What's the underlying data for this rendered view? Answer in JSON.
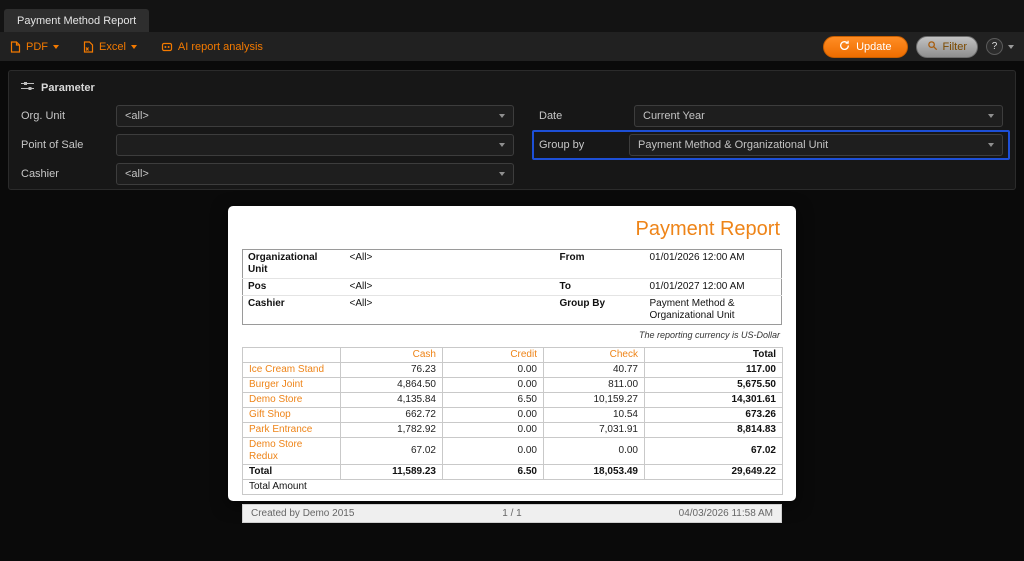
{
  "window": {
    "tab_title": "Payment Method Report"
  },
  "toolbar": {
    "pdf_label": "PDF",
    "excel_label": "Excel",
    "ai_label": "AI report analysis",
    "update_label": "Update",
    "filter_label": "Filter",
    "help_label": "?"
  },
  "parameters": {
    "title": "Parameter",
    "org_unit_label": "Org. Unit",
    "org_unit_value": "<all>",
    "point_of_sale_label": "Point of Sale",
    "point_of_sale_value": "",
    "cashier_label": "Cashier",
    "cashier_value": "<all>",
    "date_label": "Date",
    "date_value": "Current Year",
    "group_by_label": "Group by",
    "group_by_value": "Payment Method & Organizational Unit"
  },
  "report": {
    "title": "Payment Report",
    "info": {
      "org_unit_label": "Organizational Unit",
      "org_unit_value": "<All>",
      "pos_label": "Pos",
      "pos_value": "<All>",
      "cashier_label": "Cashier",
      "cashier_value": "<All>",
      "from_label": "From",
      "from_value": "01/01/2026 12:00 AM",
      "to_label": "To",
      "to_value": "01/01/2027 12:00 AM",
      "group_by_label": "Group By",
      "group_by_value": "Payment Method & Organizational Unit"
    },
    "currency_note": "The reporting currency is US-Dollar",
    "table": {
      "columns": [
        "",
        "Cash",
        "Credit",
        "Check",
        "Total"
      ],
      "rows": [
        [
          "Ice Cream Stand",
          "76.23",
          "0.00",
          "40.77",
          "117.00"
        ],
        [
          "Burger Joint",
          "4,864.50",
          "0.00",
          "811.00",
          "5,675.50"
        ],
        [
          "Demo Store",
          "4,135.84",
          "6.50",
          "10,159.27",
          "14,301.61"
        ],
        [
          "Gift Shop",
          "662.72",
          "0.00",
          "10.54",
          "673.26"
        ],
        [
          "Park Entrance",
          "1,782.92",
          "0.00",
          "7,031.91",
          "8,814.83"
        ],
        [
          "Demo Store Redux",
          "67.02",
          "0.00",
          "0.00",
          "67.02"
        ]
      ],
      "total_row": [
        "Total",
        "11,589.23",
        "6.50",
        "18,053.49",
        "29,649.22"
      ],
      "total_amount_label": "Total Amount"
    },
    "footer": {
      "created_by": "Created by Demo 2015",
      "page": "1 / 1",
      "timestamp": "04/03/2026 11:58 AM"
    }
  },
  "colors": {
    "accent_orange": "#ee8418",
    "toolbar_orange": "#f47a00",
    "highlight_blue": "#1d4fd6"
  }
}
